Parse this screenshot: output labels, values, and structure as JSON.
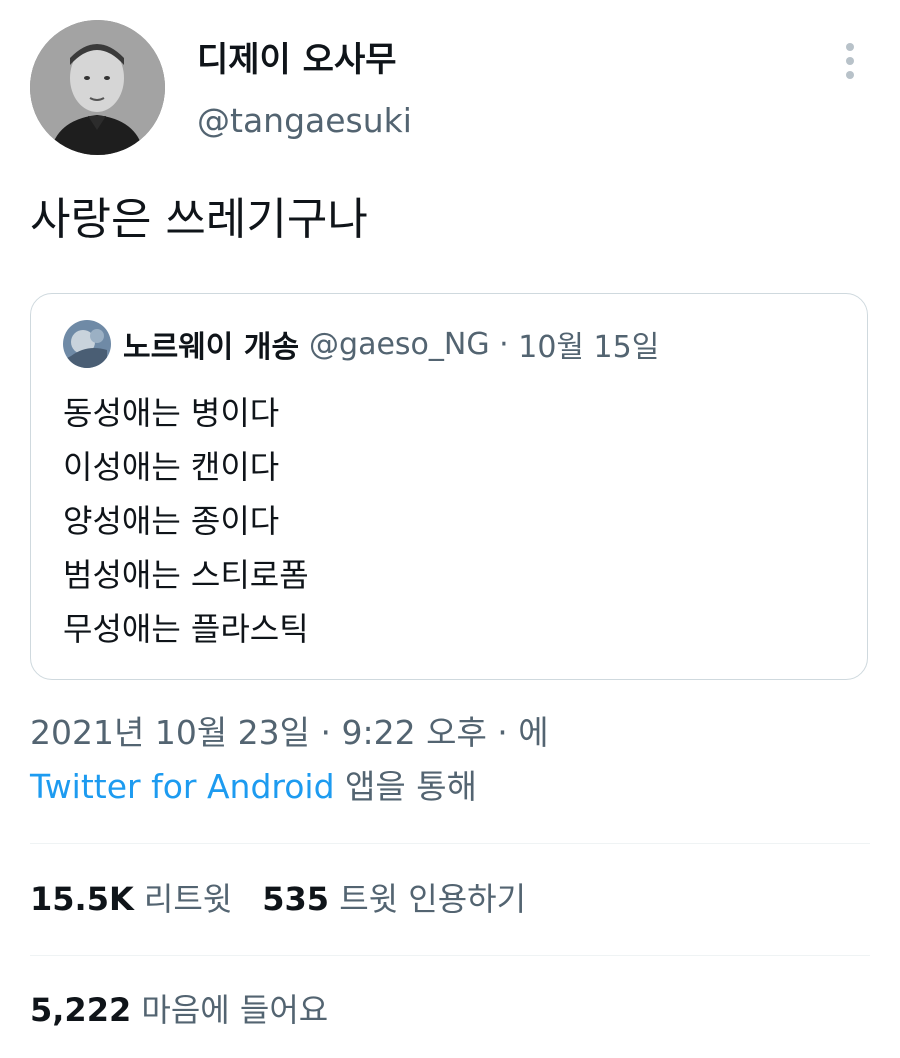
{
  "author": {
    "display_name": "디제이 오사무",
    "handle": "@tangaesuki",
    "avatar_icon": "profile-photo",
    "more_icon": "more-vertical-icon"
  },
  "tweet": {
    "text": "사랑은 쓰레기구나"
  },
  "quoted_tweet": {
    "avatar_icon": "profile-photo",
    "display_name": "노르웨이 개송",
    "handle": "@gaeso_NG",
    "separator": "·",
    "date": "10월 15일",
    "lines": [
      "동성애는 병이다",
      "이성애는 캔이다",
      "양성애는 종이다",
      "범성애는 스티로폼",
      "무성애는 플라스틱"
    ]
  },
  "meta": {
    "timestamp": "2021년 10월 23일 · 9:22 오후 · 에",
    "source_link": "Twitter for Android",
    "source_suffix": " 앱을 통해"
  },
  "stats": {
    "retweets_count": "15.5K",
    "retweets_label": "리트윗",
    "quotes_count": "535",
    "quotes_label": "트윗 인용하기",
    "likes_count": "5,222",
    "likes_label": "마음에 들어요"
  },
  "colors": {
    "text_primary": "#0f1419",
    "text_secondary": "#536471",
    "link": "#1d9bf0",
    "border": "#cfd9de",
    "divider": "#eff3f4"
  }
}
